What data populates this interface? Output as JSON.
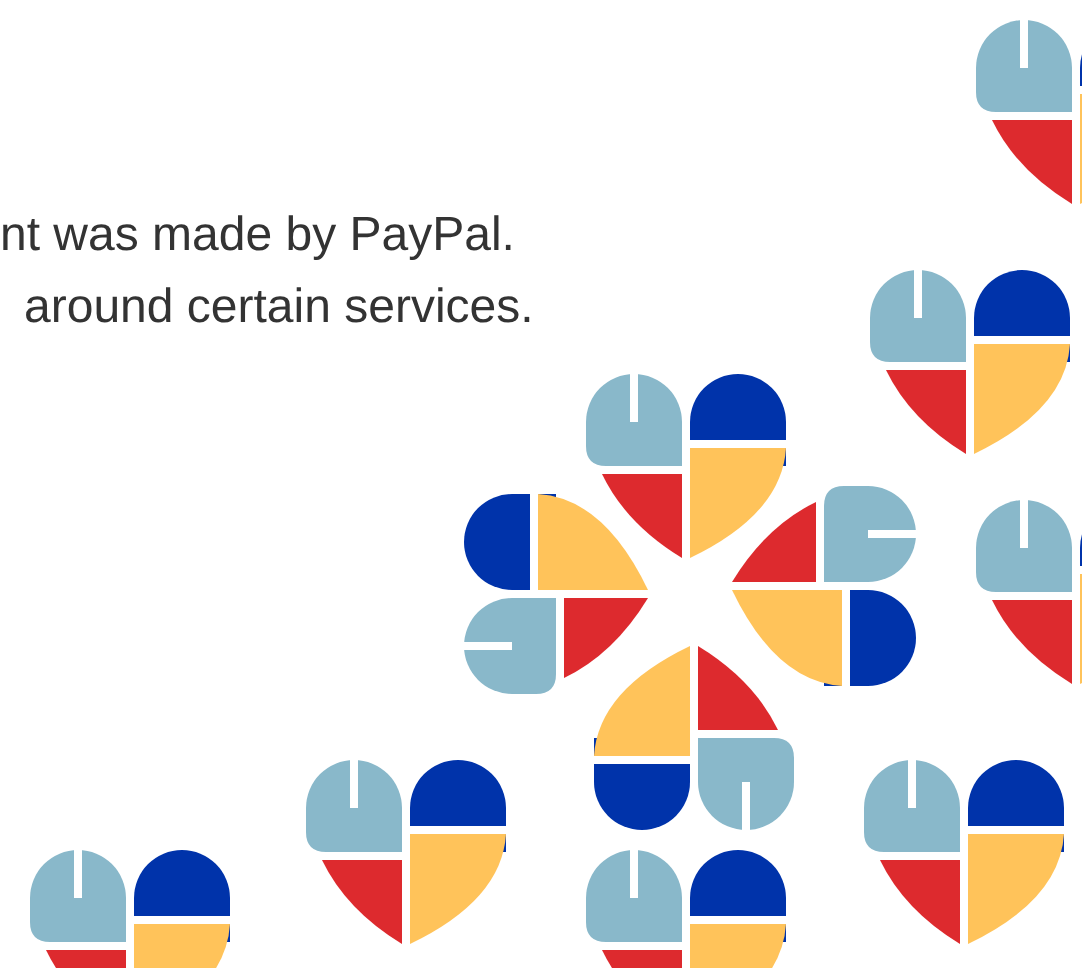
{
  "text_lines": [
    "nt was made by PayPal.",
    "around certain services."
  ]
}
